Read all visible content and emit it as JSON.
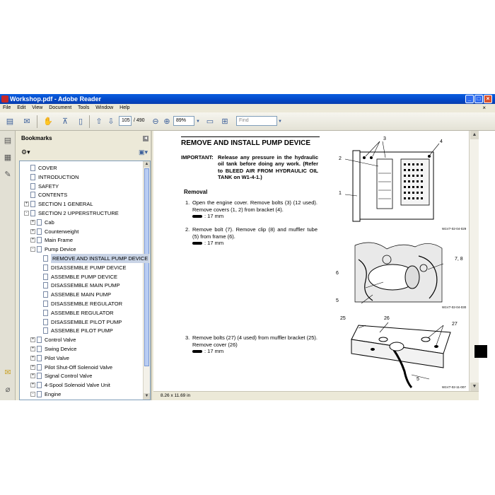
{
  "window": {
    "title": "Workshop.pdf - Adobe Reader",
    "controls": [
      "_",
      "□",
      "×"
    ]
  },
  "menu": {
    "items": [
      "File",
      "Edit",
      "View",
      "Document",
      "Tools",
      "Window",
      "Help"
    ],
    "close": "×"
  },
  "toolbar": {
    "page_current": "105",
    "page_total": "/ 490",
    "zoom": "89%",
    "find_placeholder": "Find"
  },
  "bookmarks": {
    "title": "Bookmarks",
    "items": [
      {
        "label": "COVER",
        "level": 1,
        "expander": ""
      },
      {
        "label": "INTRODUCTION",
        "level": 1,
        "expander": ""
      },
      {
        "label": "SAFETY",
        "level": 1,
        "expander": ""
      },
      {
        "label": "CONTENTS",
        "level": 1,
        "expander": ""
      },
      {
        "label": "SECTION 1 GENERAL",
        "level": 1,
        "expander": "+"
      },
      {
        "label": "SECTION 2 UPPERSTRUCTURE",
        "level": 1,
        "expander": "-"
      },
      {
        "label": "Cab",
        "level": 2,
        "expander": "+"
      },
      {
        "label": "Counterweight",
        "level": 2,
        "expander": "+"
      },
      {
        "label": "Main Frame",
        "level": 2,
        "expander": "+"
      },
      {
        "label": "Pump Device",
        "level": 2,
        "expander": "-"
      },
      {
        "label": "REMOVE AND INSTALL PUMP DEVICE",
        "level": 3,
        "expander": "",
        "selected": true
      },
      {
        "label": "DISASSEMBLE PUMP DEVICE",
        "level": 3,
        "expander": ""
      },
      {
        "label": "ASSEMBLE PUMP DEVICE",
        "level": 3,
        "expander": ""
      },
      {
        "label": "DISASSEMBLE MAIN PUMP",
        "level": 3,
        "expander": ""
      },
      {
        "label": "ASSEMBLE MAIN PUMP",
        "level": 3,
        "expander": ""
      },
      {
        "label": "DISASSEMBLE REGULATOR",
        "level": 3,
        "expander": ""
      },
      {
        "label": "ASSEMBLE REGULATOR",
        "level": 3,
        "expander": ""
      },
      {
        "label": "DISASSEMBLE PILOT PUMP",
        "level": 3,
        "expander": ""
      },
      {
        "label": "ASSEMBLE PILOT PUMP",
        "level": 3,
        "expander": ""
      },
      {
        "label": "Control Valve",
        "level": 2,
        "expander": "+"
      },
      {
        "label": "Swing Device",
        "level": 2,
        "expander": "+"
      },
      {
        "label": "Pilot Valve",
        "level": 2,
        "expander": "+"
      },
      {
        "label": "Pilot Shut-Off Solenoid Valve",
        "level": 2,
        "expander": "+"
      },
      {
        "label": "Signal Control Valve",
        "level": 2,
        "expander": "+"
      },
      {
        "label": "4-Spool Solenoid Valve Unit",
        "level": 2,
        "expander": "+"
      },
      {
        "label": "Engine",
        "level": 2,
        "expander": "-"
      }
    ]
  },
  "document": {
    "title": "REMOVE AND INSTALL PUMP DEVICE",
    "important_label": "IMPORTANT:",
    "important_text": "Release any pressure in the hydraulic oil tank before doing any work. (Refer to BLEED AIR FROM HYDRAULIC OIL TANK on W1-4-1.)",
    "removal_heading": "Removal",
    "steps": [
      {
        "num": "1.",
        "text": "Open the engine cover. Remove bolts (3) (12 used). Remove covers (1, 2) from bracket (4).",
        "tool": ": 17 mm"
      },
      {
        "num": "2.",
        "text": "Remove bolt (7). Remove clip (8) and muffler tube (5) from frame (6).",
        "tool": ": 17 mm"
      },
      {
        "num": "3.",
        "text": "Remove bolts (27) (4 used) from muffler bracket (25). Remove cover (26)",
        "tool": ": 17 mm"
      }
    ],
    "fig1": {
      "labels": [
        "3",
        "4",
        "2",
        "1"
      ],
      "caption": "W1V7-02-04-029"
    },
    "fig2": {
      "labels": [
        "7, 8",
        "6",
        "5"
      ],
      "caption": "W1V7-02-04-030"
    },
    "fig3": {
      "labels": [
        "25",
        "26",
        "27",
        "5"
      ],
      "caption": "W1V7-02-11-007"
    }
  },
  "status": {
    "page_size": "8.26 x 11.69 in"
  }
}
